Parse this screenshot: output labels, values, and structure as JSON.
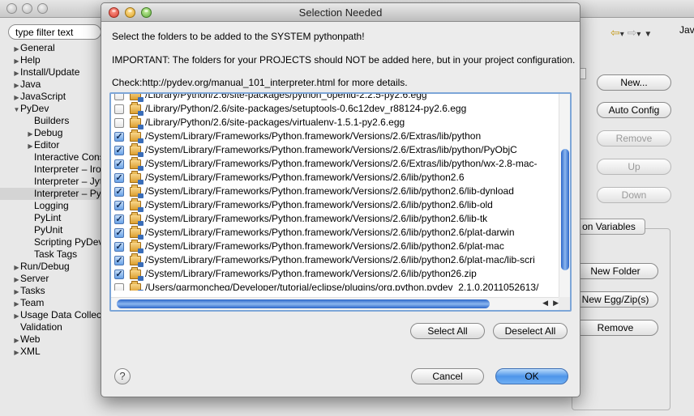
{
  "background": {
    "filter_placeholder": "type filter text",
    "tree": [
      {
        "label": "General",
        "expander": "▶",
        "indent": 0,
        "selected": false
      },
      {
        "label": "Help",
        "expander": "▶",
        "indent": 0,
        "selected": false
      },
      {
        "label": "Install/Update",
        "expander": "▶",
        "indent": 0,
        "selected": false
      },
      {
        "label": "Java",
        "expander": "▶",
        "indent": 0,
        "selected": false
      },
      {
        "label": "JavaScript",
        "expander": "▶",
        "indent": 0,
        "selected": false
      },
      {
        "label": "PyDev",
        "expander": "▼",
        "indent": 0,
        "selected": false
      },
      {
        "label": "Builders",
        "expander": "",
        "indent": 1,
        "selected": false
      },
      {
        "label": "Debug",
        "expander": "▶",
        "indent": 1,
        "selected": false
      },
      {
        "label": "Editor",
        "expander": "▶",
        "indent": 1,
        "selected": false
      },
      {
        "label": "Interactive Cons",
        "expander": "",
        "indent": 1,
        "selected": false
      },
      {
        "label": "Interpreter – Iro",
        "expander": "",
        "indent": 1,
        "selected": false
      },
      {
        "label": "Interpreter – Jyt",
        "expander": "",
        "indent": 1,
        "selected": false
      },
      {
        "label": "Interpreter – Py",
        "expander": "",
        "indent": 1,
        "selected": true
      },
      {
        "label": "Logging",
        "expander": "",
        "indent": 1,
        "selected": false
      },
      {
        "label": "PyLint",
        "expander": "",
        "indent": 1,
        "selected": false
      },
      {
        "label": "PyUnit",
        "expander": "",
        "indent": 1,
        "selected": false
      },
      {
        "label": "Scripting PyDev",
        "expander": "",
        "indent": 1,
        "selected": false
      },
      {
        "label": "Task Tags",
        "expander": "",
        "indent": 1,
        "selected": false
      },
      {
        "label": "Run/Debug",
        "expander": "▶",
        "indent": 0,
        "selected": false
      },
      {
        "label": "Server",
        "expander": "▶",
        "indent": 0,
        "selected": false
      },
      {
        "label": "Tasks",
        "expander": "▶",
        "indent": 0,
        "selected": false
      },
      {
        "label": "Team",
        "expander": "▶",
        "indent": 0,
        "selected": false
      },
      {
        "label": "Usage Data Collect",
        "expander": "▶",
        "indent": 0,
        "selected": false
      },
      {
        "label": "Validation",
        "expander": "",
        "indent": 0,
        "selected": false
      },
      {
        "label": "Web",
        "expander": "▶",
        "indent": 0,
        "selected": false
      },
      {
        "label": "XML",
        "expander": "▶",
        "indent": 0,
        "selected": false
      }
    ],
    "java_tab": "Jav",
    "buttons": {
      "new": "New...",
      "auto_config": "Auto Config",
      "remove": "Remove",
      "up": "Up",
      "down": "Down",
      "env_tab": "on Variables",
      "new_folder": "New Folder",
      "new_egg": "New Egg/Zip(s)",
      "remove2": "Remove"
    }
  },
  "dialog": {
    "title": "Selection Needed",
    "message1": "Select the folders to be added to the SYSTEM pythonpath!",
    "message2": "IMPORTANT: The folders for your PROJECTS should NOT be added here, but in your project configuration.",
    "message3": "Check:http://pydev.org/manual_101_interpreter.html for more details.",
    "folders": [
      {
        "path": "/Library/Python/2.6/site-packages/python_openid-2.2.5-py2.6.egg",
        "checked": false
      },
      {
        "path": "/Library/Python/2.6/site-packages/setuptools-0.6c12dev_r88124-py2.6.egg",
        "checked": false
      },
      {
        "path": "/Library/Python/2.6/site-packages/virtualenv-1.5.1-py2.6.egg",
        "checked": false
      },
      {
        "path": "/System/Library/Frameworks/Python.framework/Versions/2.6/Extras/lib/python",
        "checked": true
      },
      {
        "path": "/System/Library/Frameworks/Python.framework/Versions/2.6/Extras/lib/python/PyObjC",
        "checked": true
      },
      {
        "path": "/System/Library/Frameworks/Python.framework/Versions/2.6/Extras/lib/python/wx-2.8-mac-",
        "checked": true
      },
      {
        "path": "/System/Library/Frameworks/Python.framework/Versions/2.6/lib/python2.6",
        "checked": true
      },
      {
        "path": "/System/Library/Frameworks/Python.framework/Versions/2.6/lib/python2.6/lib-dynload",
        "checked": true
      },
      {
        "path": "/System/Library/Frameworks/Python.framework/Versions/2.6/lib/python2.6/lib-old",
        "checked": true
      },
      {
        "path": "/System/Library/Frameworks/Python.framework/Versions/2.6/lib/python2.6/lib-tk",
        "checked": true
      },
      {
        "path": "/System/Library/Frameworks/Python.framework/Versions/2.6/lib/python2.6/plat-darwin",
        "checked": true
      },
      {
        "path": "/System/Library/Frameworks/Python.framework/Versions/2.6/lib/python2.6/plat-mac",
        "checked": true
      },
      {
        "path": "/System/Library/Frameworks/Python.framework/Versions/2.6/lib/python2.6/plat-mac/lib-scri",
        "checked": true
      },
      {
        "path": "/System/Library/Frameworks/Python.framework/Versions/2.6/lib/python26.zip",
        "checked": true
      },
      {
        "path": "/Users/garmoncheg/Developer/tutorial/eclipse/plugins/org.python.pydev_2.1.0.2011052613/",
        "checked": false
      }
    ],
    "select_all": "Select All",
    "deselect_all": "Deselect All",
    "cancel": "Cancel",
    "ok": "OK",
    "help": "?"
  }
}
